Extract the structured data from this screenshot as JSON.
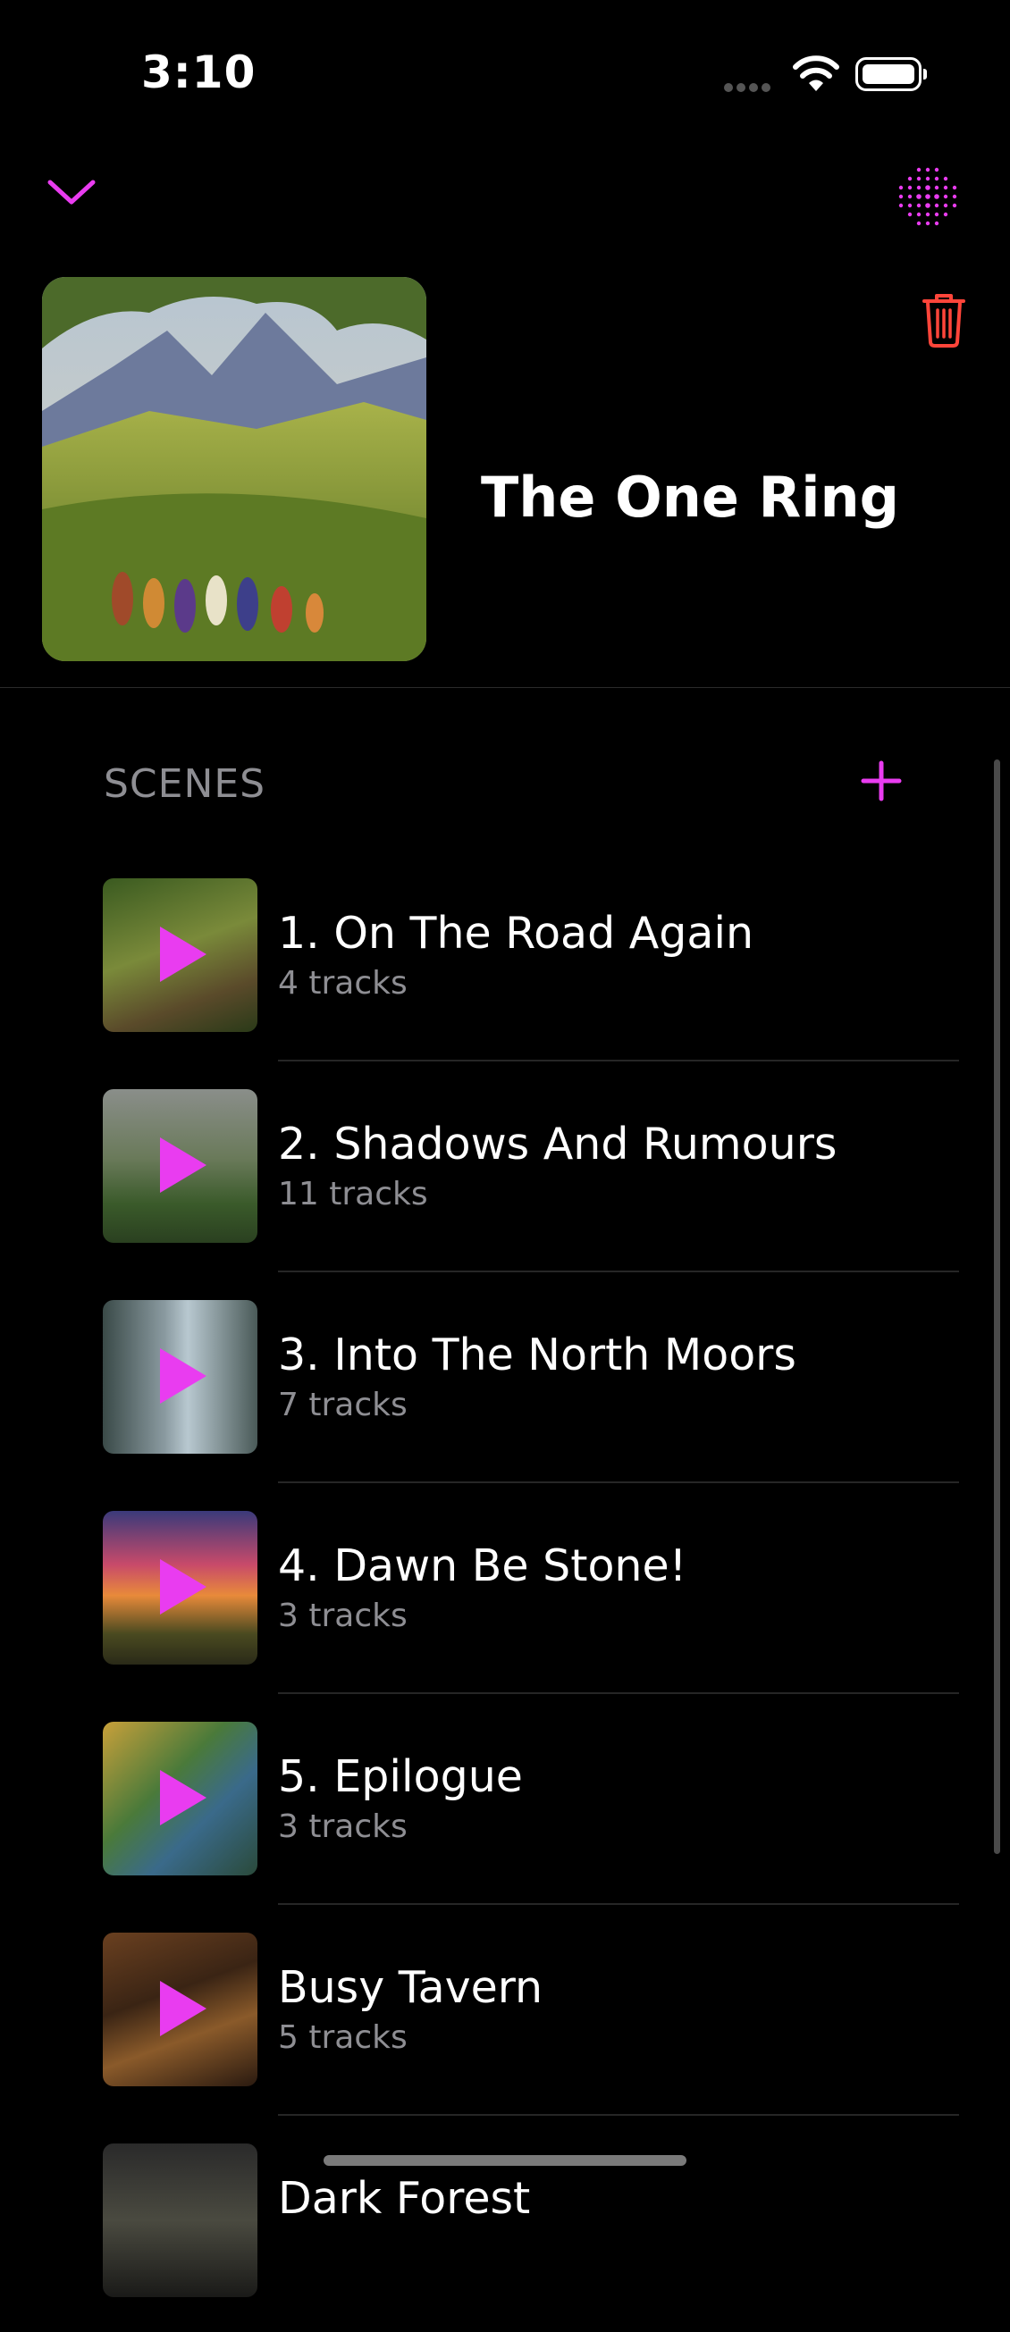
{
  "status_bar": {
    "time": "3:10"
  },
  "header": {
    "title": "The One Ring",
    "collapse_icon": "chevron-down-icon",
    "visualizer_icon": "dot-grid-icon",
    "delete_icon": "trash-icon"
  },
  "scenes_section": {
    "label": "SCENES",
    "add_icon": "plus-icon"
  },
  "scenes": [
    {
      "title": "1. On The Road Again",
      "subtitle": "4 tracks"
    },
    {
      "title": "2. Shadows And Rumours",
      "subtitle": "11 tracks"
    },
    {
      "title": "3. Into The North Moors",
      "subtitle": "7 tracks"
    },
    {
      "title": "4. Dawn Be Stone!",
      "subtitle": "3 tracks"
    },
    {
      "title": "5. Epilogue",
      "subtitle": "3 tracks"
    },
    {
      "title": "Busy Tavern",
      "subtitle": "5 tracks"
    },
    {
      "title": "Dark Forest",
      "subtitle": ""
    }
  ],
  "colors": {
    "accent": "#e93cf0",
    "destructive": "#ff453a",
    "background": "#000000",
    "secondary_text": "#8e8e93"
  }
}
